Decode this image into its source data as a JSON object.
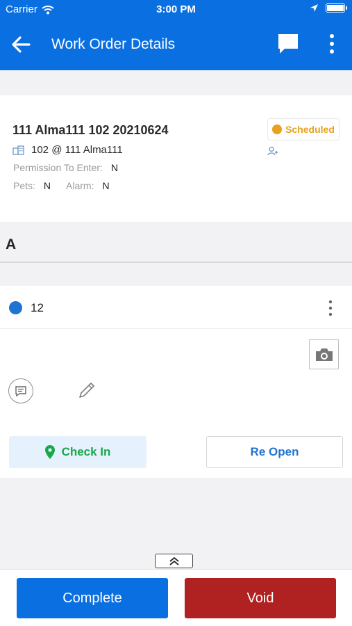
{
  "status_bar": {
    "carrier": "Carrier",
    "time": "3:00 PM",
    "icons": [
      "wifi-icon",
      "location-arrow-icon",
      "battery-icon"
    ]
  },
  "nav": {
    "title": "Work Order Details",
    "icons": [
      "back-arrow-icon",
      "chat-icon",
      "more-vertical-icon"
    ],
    "bg_color": "#0a6fe0"
  },
  "work_order": {
    "title": "111 Alma111 102 20210624",
    "location": "102 @ 111 Alma111",
    "permission_label": "Permission To Enter:",
    "permission_value": "N",
    "pets_label": "Pets:",
    "pets_value": "N",
    "alarm_label": "Alarm:",
    "alarm_value": "N",
    "status": "Scheduled",
    "status_color": "#e8a11a"
  },
  "section": {
    "label": "A"
  },
  "task": {
    "number": "12",
    "dot_color": "#1f73d1",
    "check_in_label": "Check In",
    "reopen_label": "Re Open"
  },
  "footer": {
    "complete_label": "Complete",
    "void_label": "Void",
    "complete_color": "#0a6fe0",
    "void_color": "#b02121"
  }
}
